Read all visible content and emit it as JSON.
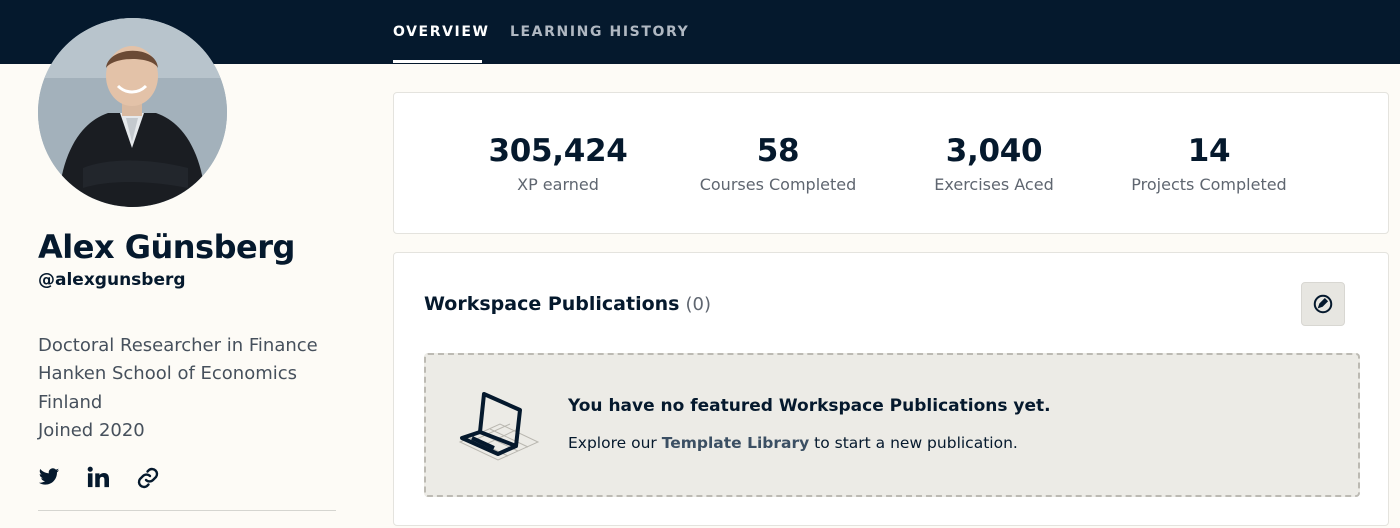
{
  "tabs": [
    {
      "label": "OVERVIEW",
      "active": true
    },
    {
      "label": "LEARNING HISTORY",
      "active": false
    }
  ],
  "profile": {
    "name": "Alex Günsberg",
    "handle": "@alexgunsberg",
    "bio": [
      "Doctoral Researcher in Finance",
      "Hanken School of Economics",
      "Finland",
      "Joined 2020"
    ],
    "social_icons": [
      "twitter-icon",
      "linkedin-icon",
      "link-icon"
    ]
  },
  "stats": [
    {
      "value": "305,424",
      "label": "XP earned"
    },
    {
      "value": "58",
      "label": "Courses Completed"
    },
    {
      "value": "3,040",
      "label": "Exercises Aced"
    },
    {
      "value": "14",
      "label": "Projects Completed"
    }
  ],
  "publications": {
    "title": "Workspace Publications",
    "count": "(0)",
    "action_icon": "edit-icon",
    "empty_title": "You have no featured Workspace Publications yet.",
    "empty_prefix": "Explore our",
    "empty_link": "Template Library",
    "empty_suffix": "to start a new publication."
  },
  "colors": {
    "header_bg": "#05192d",
    "page_bg": "#fdfbf6",
    "text_dark": "#05192d",
    "empty_bg": "#ecebe6"
  }
}
